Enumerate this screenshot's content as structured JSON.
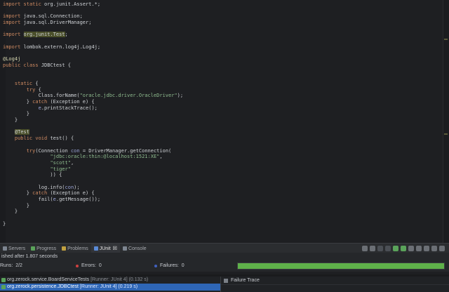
{
  "editor": {
    "lines": [
      [
        {
          "t": "import ",
          "c": "kw"
        },
        {
          "t": "static ",
          "c": "kw"
        },
        {
          "t": "org.junit.Assert.*;"
        }
      ],
      [],
      [
        {
          "t": "import ",
          "c": "kw"
        },
        {
          "t": "java.sql.Connection;"
        }
      ],
      [
        {
          "t": "import ",
          "c": "kw"
        },
        {
          "t": "java.sql.DriverManager;"
        }
      ],
      [],
      [
        {
          "t": "import ",
          "c": "kw"
        },
        {
          "t": "org.junit.Test",
          "c": "hl"
        },
        {
          "t": ";"
        }
      ],
      [],
      [
        {
          "t": "import ",
          "c": "kw"
        },
        {
          "t": "lombok.extern.log4j.Log4j;"
        }
      ],
      [],
      [
        {
          "t": "@Log4j",
          "c": "ann"
        }
      ],
      [
        {
          "t": "public ",
          "c": "kw"
        },
        {
          "t": "class ",
          "c": "kw"
        },
        {
          "t": "JDBCtest {"
        }
      ],
      [],
      [],
      [
        {
          "t": "    "
        },
        {
          "t": "static ",
          "c": "kw"
        },
        {
          "t": "{"
        }
      ],
      [
        {
          "t": "        "
        },
        {
          "t": "try ",
          "c": "kw"
        },
        {
          "t": "{"
        }
      ],
      [
        {
          "t": "            Class.forName("
        },
        {
          "t": "\"oracle.jdbc.driver.OracleDriver\"",
          "c": "str"
        },
        {
          "t": ");"
        }
      ],
      [
        {
          "t": "        } "
        },
        {
          "t": "catch ",
          "c": "kw"
        },
        {
          "t": "(Exception e) {"
        }
      ],
      [
        {
          "t": "            "
        },
        {
          "t": "e",
          "c": "var"
        },
        {
          "t": ".printStackTrace();"
        }
      ],
      [
        {
          "t": "        }"
        }
      ],
      [
        {
          "t": "    }"
        }
      ],
      [],
      [
        {
          "t": "    "
        },
        {
          "t": "@Test",
          "c": "hl"
        }
      ],
      [
        {
          "t": "    "
        },
        {
          "t": "public ",
          "c": "kw"
        },
        {
          "t": "void ",
          "c": "kw"
        },
        {
          "t": "test() {"
        }
      ],
      [],
      [
        {
          "t": "        "
        },
        {
          "t": "try",
          "c": "kw"
        },
        {
          "t": "(Connection "
        },
        {
          "t": "con",
          "c": "var"
        },
        {
          "t": " = DriverManager.getConnection("
        }
      ],
      [
        {
          "t": "                "
        },
        {
          "t": "\"jdbc:oracle:thin:@localhost:1521:XE\"",
          "c": "str"
        },
        {
          "t": ","
        }
      ],
      [
        {
          "t": "                "
        },
        {
          "t": "\"scott\"",
          "c": "str"
        },
        {
          "t": ","
        }
      ],
      [
        {
          "t": "                "
        },
        {
          "t": "\"tiger\"",
          "c": "str"
        }
      ],
      [
        {
          "t": "                )) {"
        }
      ],
      [],
      [
        {
          "t": "            log.info("
        },
        {
          "t": "con",
          "c": "var"
        },
        {
          "t": ");"
        }
      ],
      [
        {
          "t": "        } "
        },
        {
          "t": "catch ",
          "c": "kw"
        },
        {
          "t": "(Exception e) {"
        }
      ],
      [
        {
          "t": "            fail("
        },
        {
          "t": "e",
          "c": "var"
        },
        {
          "t": ".getMessage());"
        }
      ],
      [
        {
          "t": "        }"
        }
      ],
      [
        {
          "t": "    }"
        }
      ],
      [],
      [
        {
          "t": "}"
        }
      ],
      []
    ]
  },
  "panel": {
    "tabs": [
      {
        "label": "Servers",
        "icon": "servers-icon",
        "color": "#7d8590"
      },
      {
        "label": "Progress",
        "icon": "progress-icon",
        "color": "#5aa35a"
      },
      {
        "label": "Problems",
        "icon": "problems-icon",
        "color": "#c0a040"
      },
      {
        "label": "JUnit",
        "icon": "junit-icon",
        "color": "#5a8ad6",
        "active": true,
        "suffix": "☒"
      },
      {
        "label": "Console",
        "icon": "console-icon",
        "color": "#7d8590"
      }
    ]
  },
  "junit": {
    "status": "ished after 1.807 seconds",
    "runs_label": "Runs:",
    "runs_value": "2/2",
    "errors_label": "Errors:",
    "errors_value": "0",
    "failures_label": "Failures:",
    "failures_value": "0",
    "progress": 1.0,
    "colors": {
      "error": "#d04040",
      "failure": "#4060c0",
      "bar": "#5fb14a"
    },
    "tests": [
      {
        "name": "org.zerock.service.BoardServiceTests",
        "meta": "[Runner: JUnit 4] (0.132 s)",
        "selected": false
      },
      {
        "name": "org.zerock.persistence.JDBCtest",
        "meta": "[Runner: JUnit 4] (0.219 s)",
        "selected": true
      }
    ],
    "failure_trace_label": "Failure Trace"
  }
}
